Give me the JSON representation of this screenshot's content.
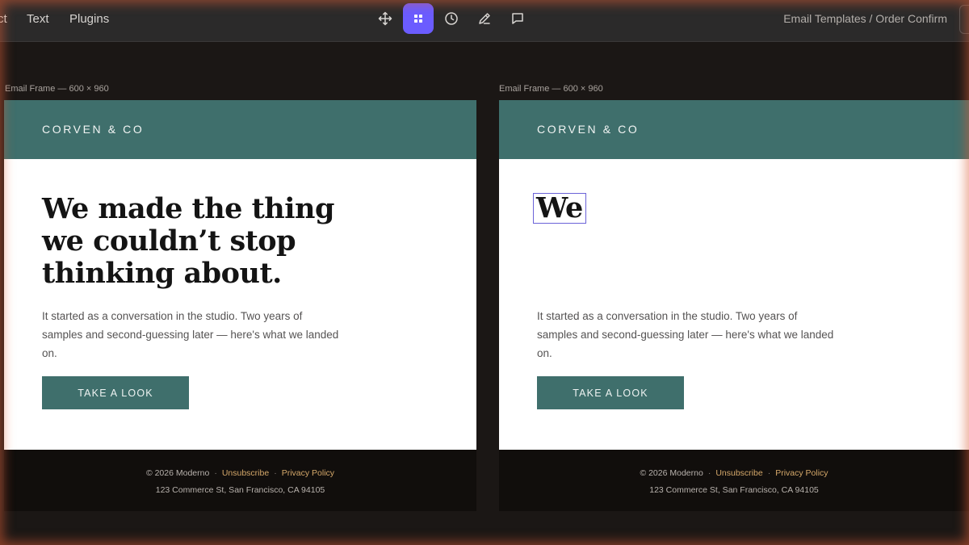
{
  "toolbar": {
    "menu": [
      "ct",
      "Text",
      "Plugins"
    ],
    "tools": [
      {
        "name": "move-icon"
      },
      {
        "name": "frame-grid-icon",
        "active": true
      },
      {
        "name": "clock-icon"
      },
      {
        "name": "pen-icon"
      },
      {
        "name": "comment-icon"
      }
    ],
    "breadcrumb": "Email Templates / Order Confirm"
  },
  "colors": {
    "accent": "#6b5cff",
    "brand_teal": "#3f6f6c",
    "footer_link": "#d5a86a"
  },
  "frames": [
    {
      "label": "Email Frame — 600 × 960",
      "brand": "CORVEN & CO",
      "headline": "We made the thing we couldn’t stop thinking about.",
      "body": "It started as a conversation in the studio. Two years of samples and second-guessing later — here's what we landed on.",
      "cta": "TAKE A LOOK",
      "footer": {
        "copyright": "© 2026 Moderno",
        "unsubscribe": "Unsubscribe",
        "privacy": "Privacy Policy",
        "address": "123 Commerce St, San Francisco, CA 94105"
      }
    },
    {
      "label": "Email Frame — 600 × 960",
      "brand": "CORVEN & CO",
      "headline": "We",
      "body": "It started as a conversation in the studio. Two years of samples and second-guessing later — here's what we landed on.",
      "cta": "TAKE A LOOK",
      "footer": {
        "copyright": "© 2026 Moderno",
        "unsubscribe": "Unsubscribe",
        "privacy": "Privacy Policy",
        "address": "123 Commerce St, San Francisco, CA 94105"
      }
    }
  ]
}
